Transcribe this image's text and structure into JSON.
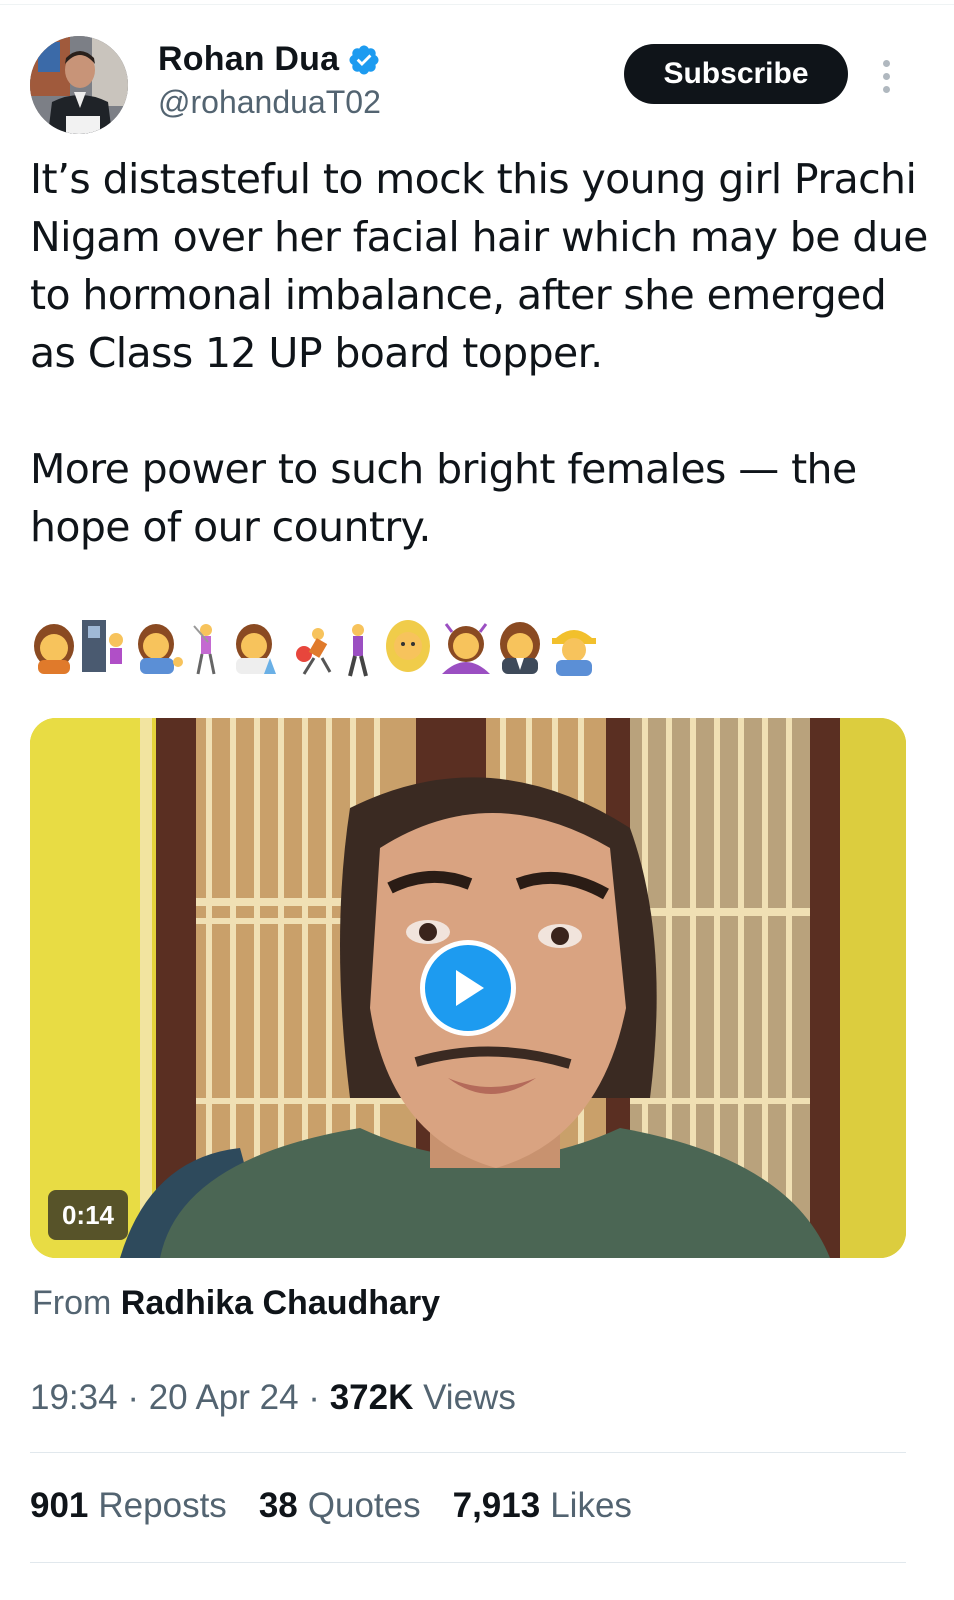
{
  "author": {
    "name": "Rohan Dua",
    "handle": "@rohanduaT02",
    "verified": true
  },
  "subscribe_label": "Subscribe",
  "tweet": {
    "paragraph1": "It’s distasteful to mock this young girl Prachi Nigam over her facial hair which may be due to hormonal imbalance, after she emerged as Class 12 UP board topper.",
    "paragraph2": "More power to such bright females — the hope of our country.",
    "emojis": "👩🧗‍♀️💁‍♀️🏌️‍♀️👩‍🔬🤾‍♀️🚶‍♀️👱‍♀️🙆‍♀️👩‍💼👷‍♀️"
  },
  "video": {
    "duration": "0:14"
  },
  "source": {
    "prefix": "From",
    "name": "Radhika Chaudhary"
  },
  "meta": {
    "time": "19:34",
    "date": "20 Apr 24",
    "views_count": "372K",
    "views_label": "Views"
  },
  "stats": {
    "reposts_count": "901",
    "reposts_label": "Reposts",
    "quotes_count": "38",
    "quotes_label": "Quotes",
    "likes_count": "7,913",
    "likes_label": "Likes"
  },
  "colors": {
    "accent": "#1d9bf0",
    "text": "#0f1419",
    "muted": "#536471",
    "button": "#0f1419"
  }
}
